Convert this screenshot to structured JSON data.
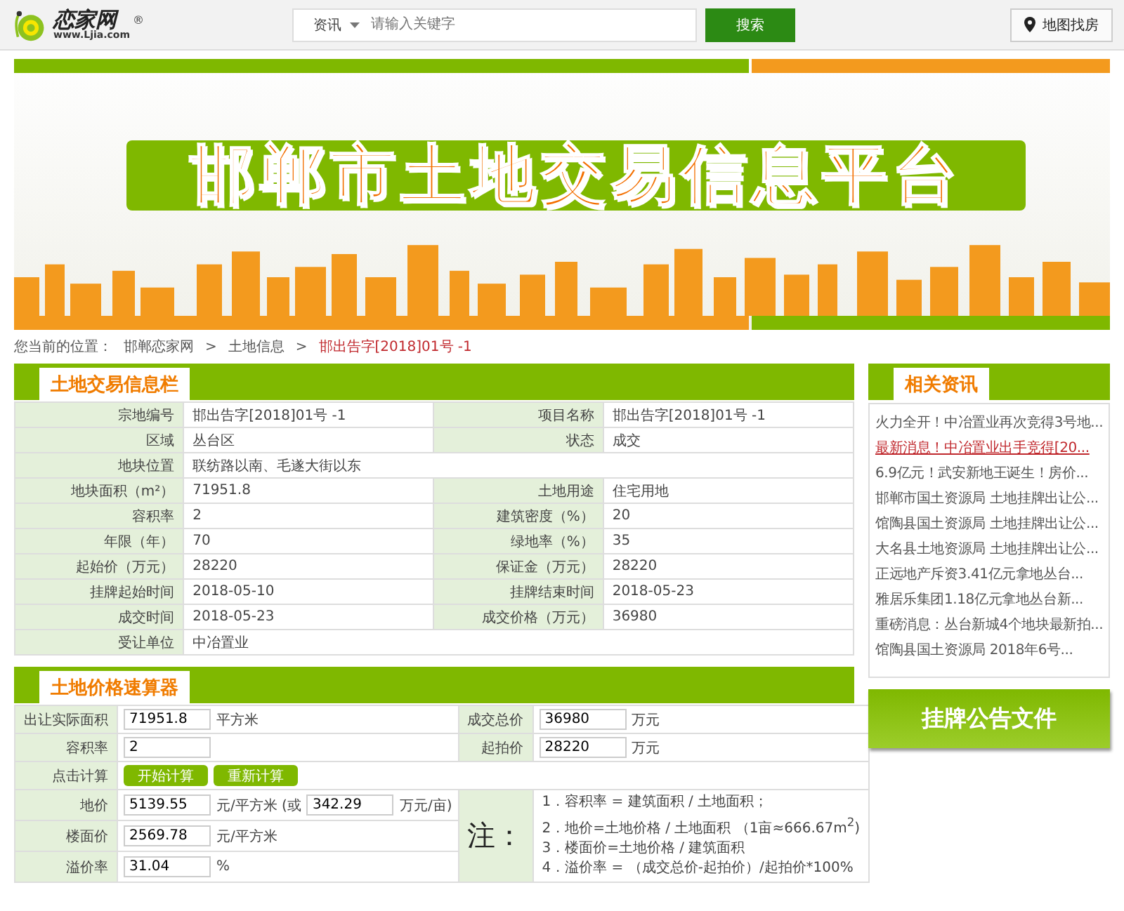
{
  "header": {
    "logo": {
      "name": "恋家网",
      "url": "www.Ljia.com",
      "mark": "®"
    },
    "search": {
      "category": "资讯",
      "placeholder": "请输入关键字",
      "button": "搜索"
    },
    "map_button": "地图找房"
  },
  "banner": {
    "title": "邯郸市土地交易信息平台"
  },
  "breadcrumb": {
    "label": "您当前的位置：",
    "items": [
      {
        "text": "邯郸恋家网",
        "current": false
      },
      {
        "text": "土地信息",
        "current": false
      },
      {
        "text": "邯出告字[2018]01号 -1",
        "current": true
      }
    ],
    "separator": ">"
  },
  "info_panel": {
    "title": "土地交易信息栏",
    "rows": [
      [
        {
          "label": "宗地编号",
          "value": "邯出告字[2018]01号 -1"
        },
        {
          "label": "项目名称",
          "value": "邯出告字[2018]01号 -1"
        }
      ],
      [
        {
          "label": "区域",
          "value": "丛台区"
        },
        {
          "label": "状态",
          "value": "成交"
        }
      ],
      [
        {
          "label": "地块位置",
          "value": "联纺路以南、毛遂大街以东"
        }
      ],
      [
        {
          "label": "地块面积（m²）",
          "value": "71951.8"
        },
        {
          "label": "土地用途",
          "value": "住宅用地"
        }
      ],
      [
        {
          "label": "容积率",
          "value": "2"
        },
        {
          "label": "建筑密度（%）",
          "value": "20"
        }
      ],
      [
        {
          "label": "年限（年）",
          "value": "70"
        },
        {
          "label": "绿地率（%）",
          "value": "35"
        }
      ],
      [
        {
          "label": "起始价（万元）",
          "value": "28220"
        },
        {
          "label": "保证金（万元）",
          "value": "28220"
        }
      ],
      [
        {
          "label": "挂牌起始时间",
          "value": "2018-05-10"
        },
        {
          "label": "挂牌结束时间",
          "value": "2018-05-23"
        }
      ],
      [
        {
          "label": "成交时间",
          "value": "2018-05-23"
        },
        {
          "label": "成交价格（万元）",
          "value": "36980"
        }
      ],
      [
        {
          "label": "受让单位",
          "value": "中冶置业"
        }
      ]
    ]
  },
  "calculator": {
    "title": "土地价格速算器",
    "area": {
      "label": "出让实际面积",
      "value": "71951.8",
      "unit": "平方米"
    },
    "ratio": {
      "label": "容积率",
      "value": "2"
    },
    "actions": {
      "label": "点击计算",
      "buttons": [
        "开始计算",
        "重新计算"
      ]
    },
    "land_price": {
      "label": "地价",
      "value": "5139.55",
      "unit": "元/平方米 (或",
      "value_2": "342.29",
      "unit_2": "万元/亩)"
    },
    "floor_price": {
      "label": "楼面价",
      "value": "2569.78",
      "unit": "元/平方米"
    },
    "premium": {
      "label": "溢价率",
      "value": "31.04",
      "unit": "%"
    },
    "total": {
      "label": "成交总价",
      "value": "36980",
      "unit": "万元"
    },
    "start": {
      "label": "起拍价",
      "value": "28220",
      "unit": "万元"
    },
    "notes": {
      "label": "注：",
      "lines": [
        "1．容积率 = 建筑面积 / 土地面积；",
        "2．地价=土地价格 / 土地面积 （1亩≈666.67m$^{2}$)",
        "3．楼面价=土地价格 / 建筑面积",
        "4．溢价率 = （成交总价-起拍价）/起拍价*100%"
      ]
    }
  },
  "news_panel": {
    "title": "相关资讯",
    "items": [
      {
        "text": "火力全开！中冶置业再次竞得3号地...",
        "selected": false
      },
      {
        "text": "最新消息！中冶置业出手竞得[20...",
        "selected": true
      },
      {
        "text": "6.9亿元！武安新地王诞生！房价...",
        "selected": false
      },
      {
        "text": "邯郸市国土资源局 土地挂牌出让公...",
        "selected": false
      },
      {
        "text": "馆陶县国土资源局 土地挂牌出让公...",
        "selected": false
      },
      {
        "text": "大名县土地资源局 土地挂牌出让公...",
        "selected": false
      },
      {
        "text": "正远地产斥资3.41亿元拿地丛台...",
        "selected": false
      },
      {
        "text": "雅居乐集团1.18亿元拿地丛台新...",
        "selected": false
      },
      {
        "text": "重磅消息：丛台新城4个地块最新拍...",
        "selected": false
      },
      {
        "text": "馆陶县国土资源局 2018年6号...",
        "selected": false
      }
    ]
  },
  "notice_button": "挂牌公告文件"
}
